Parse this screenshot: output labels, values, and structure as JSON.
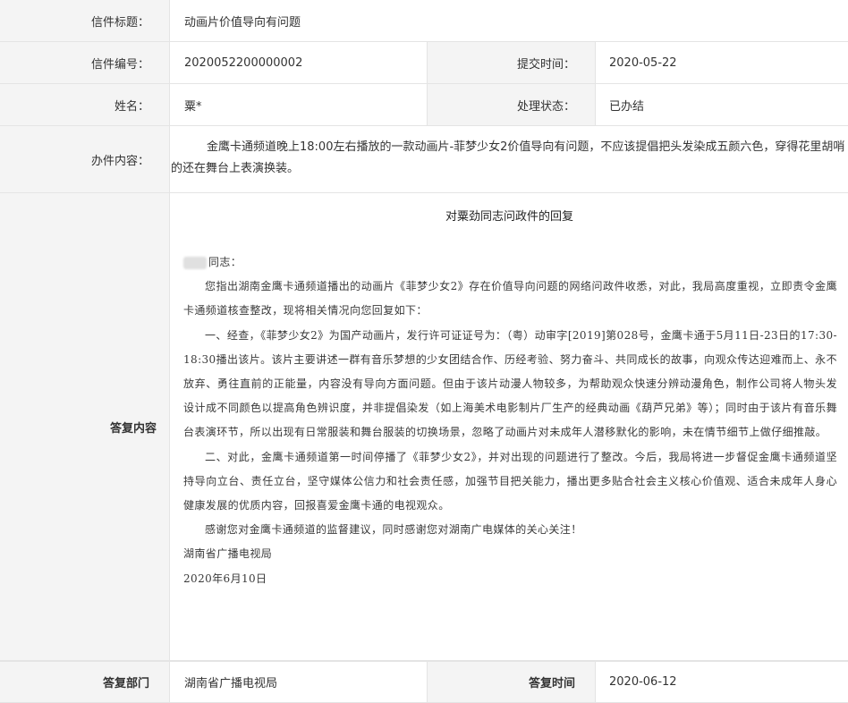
{
  "rows": {
    "title_label": "信件标题：",
    "title_value": "动画片价值导向有问题",
    "number_label": "信件编号：",
    "number_value": "2020052200000002",
    "submit_label": "提交时间：",
    "submit_value": "2020-05-22",
    "name_label": "姓名：",
    "name_value": "粟*",
    "status_label": "处理状态：",
    "status_value": "已办结",
    "content_label": "办件内容：",
    "content_value_1": "金鹰卡通频道晚上18:00左右播放的一款动画片-菲梦少女2价值导向有问题，不应该提倡把头发染成五颜六色，穿得花里胡哨",
    "content_value_2": "的还在舞台上表演换装。"
  },
  "reply": {
    "label": "答复内容",
    "title": "对粟劲同志问政件的回复",
    "greeting": "同志：",
    "p1": "您指出湖南金鹰卡通频道播出的动画片《菲梦少女2》存在价值导向问题的网络问政件收悉，对此，我局高度重视，立即责令金鹰卡通频道核查整改，现将相关情况向您回复如下：",
    "p2": "一、经查，《菲梦少女2》为国产动画片，发行许可证证号为：（粤）动审字[2019]第028号，金鹰卡通于5月11日-23日的17:30-18:30播出该片。该片主要讲述一群有音乐梦想的少女团结合作、历经考验、努力奋斗、共同成长的故事，向观众传达迎难而上、永不放弃、勇往直前的正能量，内容没有导向方面问题。但由于该片动漫人物较多，为帮助观众快速分辨动漫角色，制作公司将人物头发设计成不同颜色以提高角色辨识度，并非提倡染发（如上海美术电影制片厂生产的经典动画《葫芦兄弟》等）；同时由于该片有音乐舞台表演环节，所以出现有日常服装和舞台服装的切换场景，忽略了动画片对未成年人潜移默化的影响，未在情节细节上做仔细推敲。",
    "p3": "二、对此，金鹰卡通频道第一时间停播了《菲梦少女2》，并对出现的问题进行了整改。今后，我局将进一步督促金鹰卡通频道坚持导向立台、责任立台，坚守媒体公信力和社会责任感，加强节目把关能力，播出更多贴合社会主义核心价值观、适合未成年人身心健康发展的优质内容，回报喜爱金鹰卡通的电视观众。",
    "p4": "感谢您对金鹰卡通频道的监督建议，同时感谢您对湖南广电媒体的关心关注！",
    "sign_org": "湖南省广播电视局",
    "sign_date": "2020年6月10日"
  },
  "footer": {
    "dept_label": "答复部门",
    "dept_value": "湖南省广播电视局",
    "time_label": "答复时间",
    "time_value": "2020-06-12"
  }
}
